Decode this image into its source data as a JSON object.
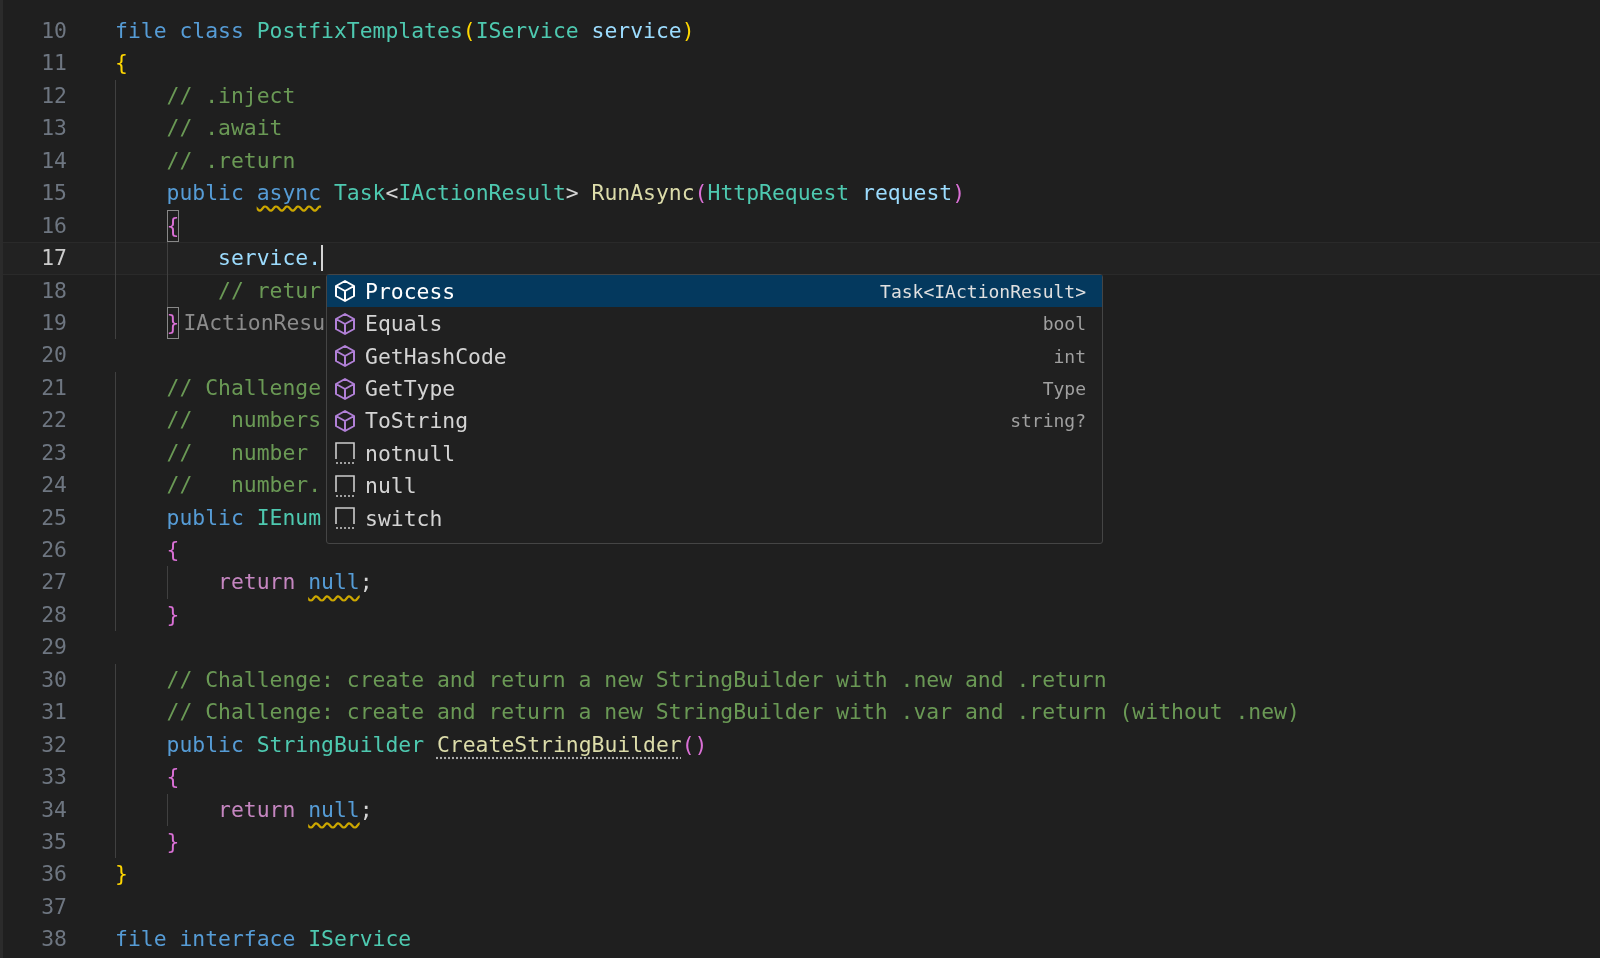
{
  "editor": {
    "lines": [
      {
        "number": "10",
        "current": false,
        "tokens": [
          {
            "kind": "keyword",
            "t": "file"
          },
          {
            "kind": "keyword",
            "t": " class"
          },
          {
            "kind": "type",
            "t": " PostfixTemplates"
          },
          {
            "kind": "brace1",
            "t": "("
          },
          {
            "kind": "type",
            "t": "IService"
          },
          {
            "kind": "param",
            "t": " service"
          },
          {
            "kind": "brace1",
            "t": ")"
          }
        ]
      },
      {
        "number": "11",
        "current": false,
        "tokens": [
          {
            "kind": "brace1",
            "t": "{"
          }
        ]
      },
      {
        "number": "12",
        "current": false,
        "kind": "class",
        "tokens": [
          {
            "kind": "comment",
            "t": "// .inject"
          }
        ]
      },
      {
        "number": "13",
        "current": false,
        "kind": "class",
        "tokens": [
          {
            "kind": "comment",
            "t": "// .await"
          }
        ]
      },
      {
        "number": "14",
        "current": false,
        "kind": "class",
        "tokens": [
          {
            "kind": "comment",
            "t": "// .return"
          }
        ]
      },
      {
        "number": "15",
        "current": false,
        "kind": "class",
        "tokens": [
          {
            "kind": "keyword",
            "t": "public"
          },
          {
            "kind": "keyword",
            "t": " async",
            "squiggle": true
          },
          {
            "kind": "type",
            "t": " Task"
          },
          {
            "kind": "plain",
            "t": "<"
          },
          {
            "kind": "type",
            "t": "IActionResult"
          },
          {
            "kind": "plain",
            "t": ">"
          },
          {
            "kind": "method",
            "t": " RunAsync"
          },
          {
            "kind": "brace2",
            "t": "("
          },
          {
            "kind": "type",
            "t": "HttpRequest"
          },
          {
            "kind": "param",
            "t": " request"
          },
          {
            "kind": "brace2",
            "t": ")"
          }
        ]
      },
      {
        "number": "16",
        "current": false,
        "kind": "class",
        "tokens": [
          {
            "kind": "brace2",
            "t": "{",
            "bracket_match": true
          }
        ]
      },
      {
        "number": "17",
        "current": true,
        "kind": "member",
        "cursor": true,
        "tokens": [
          {
            "kind": "param",
            "t": "service."
          }
        ]
      },
      {
        "number": "18",
        "current": false,
        "kind": "member",
        "tokens": [
          {
            "kind": "comment",
            "t": "// retur"
          }
        ]
      },
      {
        "number": "19",
        "current": false,
        "kind": "class",
        "tokens": [
          {
            "kind": "brace2",
            "t": "}",
            "bracket_match": true
          },
          {
            "kind": "hint",
            "t": "IActionResu"
          }
        ]
      },
      {
        "number": "20",
        "current": false
      },
      {
        "number": "21",
        "current": false,
        "kind": "class",
        "tokens": [
          {
            "kind": "comment",
            "t": "// Challenge"
          }
        ]
      },
      {
        "number": "22",
        "current": false,
        "kind": "class",
        "tokens": [
          {
            "kind": "comment",
            "t": "//   numbers"
          }
        ]
      },
      {
        "number": "23",
        "current": false,
        "kind": "class",
        "tokens": [
          {
            "kind": "comment",
            "t": "//   number"
          }
        ]
      },
      {
        "number": "24",
        "current": false,
        "kind": "class",
        "tokens": [
          {
            "kind": "comment",
            "t": "//   number."
          }
        ]
      },
      {
        "number": "25",
        "current": false,
        "kind": "class",
        "tokens": [
          {
            "kind": "keyword",
            "t": "public"
          },
          {
            "kind": "type",
            "t": " IEnum"
          }
        ]
      },
      {
        "number": "26",
        "current": false,
        "kind": "class",
        "tokens": [
          {
            "kind": "brace2",
            "t": "{"
          }
        ]
      },
      {
        "number": "27",
        "current": false,
        "kind": "member",
        "tokens": [
          {
            "kind": "control",
            "t": "return"
          },
          {
            "kind": "keyword",
            "t": " null",
            "squiggle": true
          },
          {
            "kind": "plain",
            "t": ";"
          }
        ]
      },
      {
        "number": "28",
        "current": false,
        "kind": "class",
        "tokens": [
          {
            "kind": "brace2",
            "t": "}"
          }
        ]
      },
      {
        "number": "29",
        "current": false
      },
      {
        "number": "30",
        "current": false,
        "kind": "class",
        "tokens": [
          {
            "kind": "comment",
            "t": "// Challenge: create and return a new StringBuilder with .new and .return"
          }
        ]
      },
      {
        "number": "31",
        "current": false,
        "kind": "class",
        "tokens": [
          {
            "kind": "comment",
            "t": "// Challenge: create and return a new StringBuilder with .var and .return (without .new)"
          }
        ]
      },
      {
        "number": "32",
        "current": false,
        "kind": "class",
        "tokens": [
          {
            "kind": "keyword",
            "t": "public"
          },
          {
            "kind": "type",
            "t": " StringBuilder"
          },
          {
            "kind": "method",
            "t": " CreateStringBuilder",
            "dotted": true
          },
          {
            "kind": "brace2",
            "t": "()"
          }
        ]
      },
      {
        "number": "33",
        "current": false,
        "kind": "class",
        "tokens": [
          {
            "kind": "brace2",
            "t": "{"
          }
        ]
      },
      {
        "number": "34",
        "current": false,
        "kind": "member",
        "tokens": [
          {
            "kind": "control",
            "t": "return"
          },
          {
            "kind": "keyword",
            "t": " null",
            "squiggle": true
          },
          {
            "kind": "plain",
            "t": ";"
          }
        ]
      },
      {
        "number": "35",
        "current": false,
        "kind": "class",
        "tokens": [
          {
            "kind": "brace2",
            "t": "}"
          }
        ]
      },
      {
        "number": "36",
        "current": false,
        "tokens": [
          {
            "kind": "brace1",
            "t": "}"
          }
        ]
      },
      {
        "number": "37",
        "current": false
      },
      {
        "number": "38",
        "current": false,
        "tokens": [
          {
            "kind": "keyword",
            "t": "file"
          },
          {
            "kind": "keyword",
            "t": " interface"
          },
          {
            "kind": "type",
            "t": " IService"
          }
        ]
      }
    ]
  },
  "suggestions": [
    {
      "kind": "method",
      "label": "Process",
      "detail": "Task<IActionResult>",
      "selected": true
    },
    {
      "kind": "method",
      "label": "Equals",
      "detail": "bool",
      "selected": false
    },
    {
      "kind": "method",
      "label": "GetHashCode",
      "detail": "int",
      "selected": false
    },
    {
      "kind": "method",
      "label": "GetType",
      "detail": "Type",
      "selected": false
    },
    {
      "kind": "method",
      "label": "ToString",
      "detail": "string?",
      "selected": false
    },
    {
      "kind": "snippet",
      "label": "notnull",
      "selected": false
    },
    {
      "kind": "snippet",
      "label": "null",
      "selected": false
    },
    {
      "kind": "snippet",
      "label": "switch",
      "selected": false
    }
  ]
}
